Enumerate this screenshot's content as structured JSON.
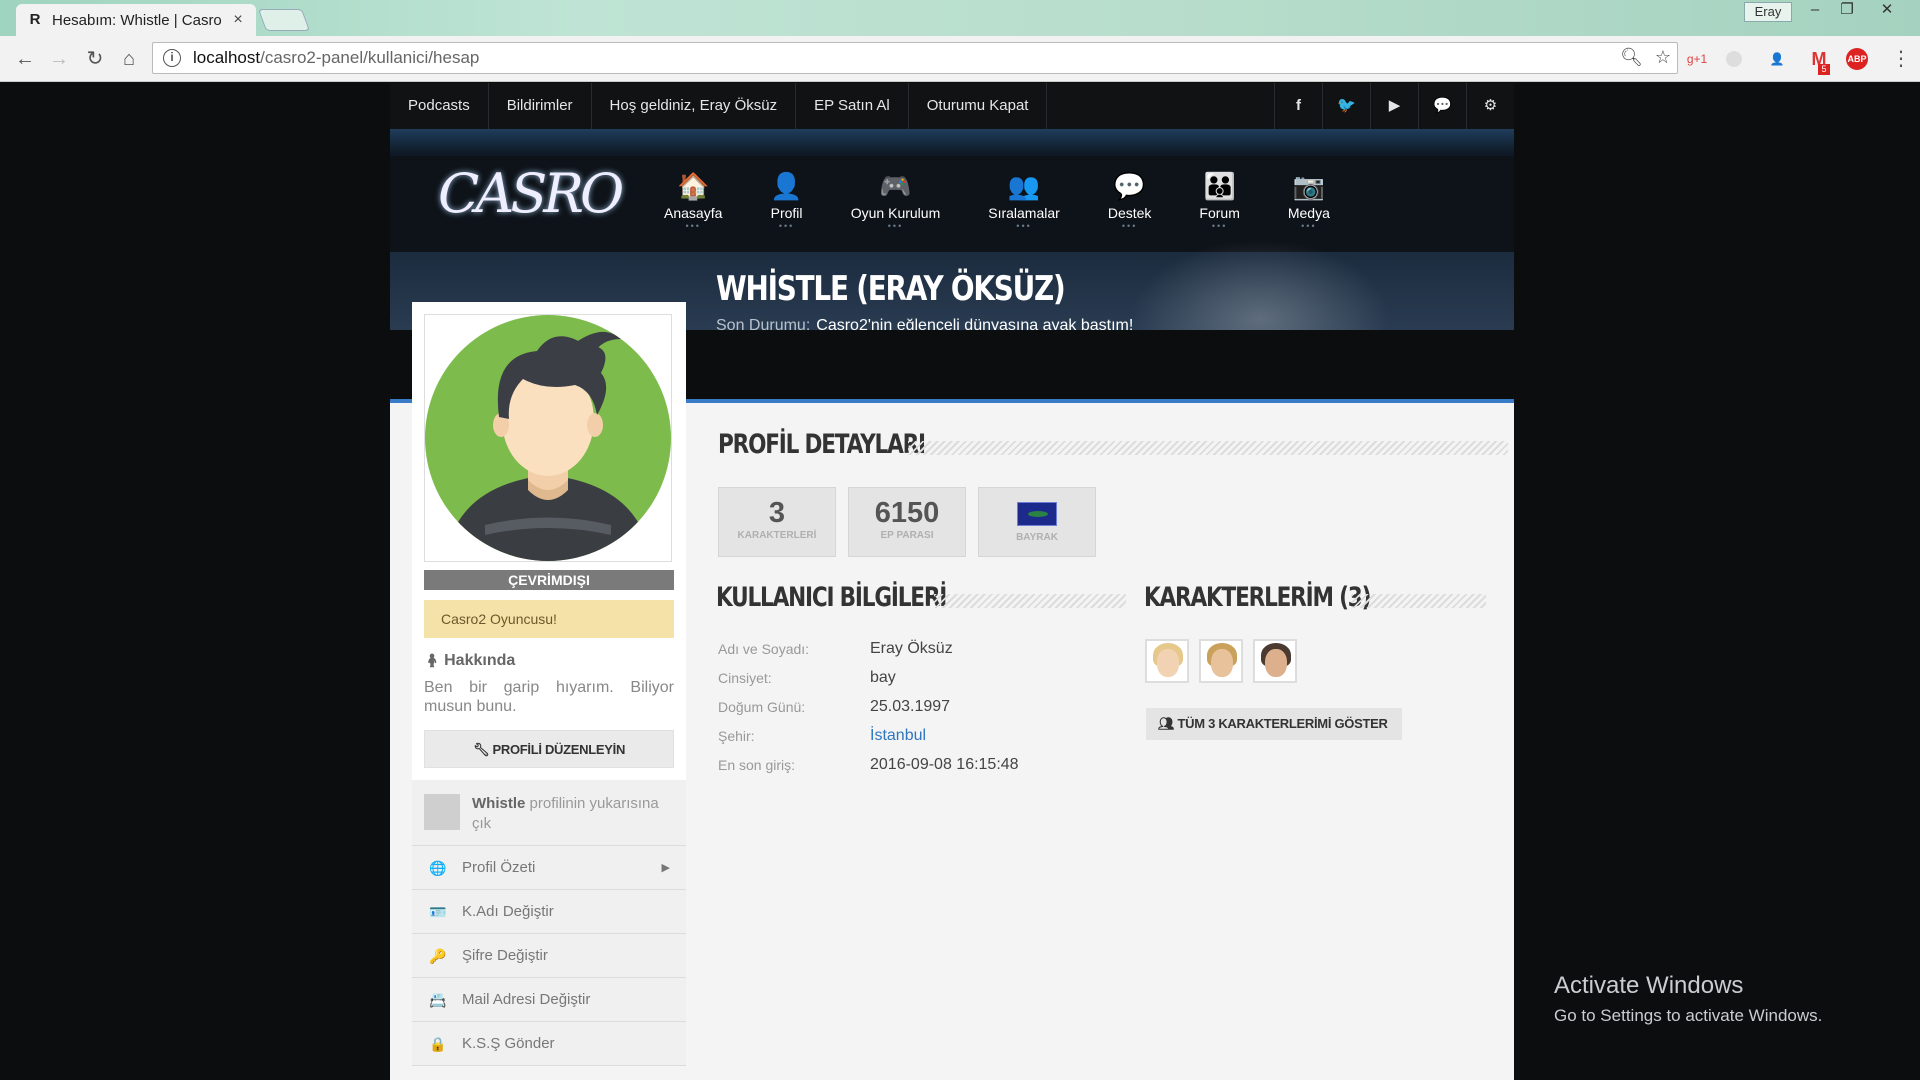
{
  "browser": {
    "tab_title": "Hesabım: Whistle | Casro",
    "tab_favicon": "R",
    "tab_close": "×",
    "profile_chip": "Eray",
    "win_controls": [
      "–",
      "❐",
      "✕"
    ],
    "url_host": "localhost",
    "url_path": "/casro2-panel/kullanici/hesap",
    "nav_icons": [
      "back-icon",
      "forward-icon",
      "reload-icon",
      "home-icon"
    ],
    "extensions": [
      {
        "name": "google-plus-ext",
        "text": "g+1",
        "color": "#d44"
      },
      {
        "name": "gray-ext",
        "text": "",
        "color": "#ddd"
      },
      {
        "name": "user-ext",
        "text": "👤",
        "color": "#2a6ed8"
      },
      {
        "name": "gmail-ext",
        "text": "M",
        "color": "#d33",
        "badge": "5"
      },
      {
        "name": "adblock-ext",
        "text": "ABP",
        "color": "#d22"
      }
    ]
  },
  "topbar": {
    "links": [
      "Podcasts",
      "Bildirimler",
      "Hoş geldiniz, Eray Öksüz",
      "EP Satın Al",
      "Oturumu Kapat"
    ],
    "social": [
      {
        "name": "facebook-icon",
        "glyph": "f"
      },
      {
        "name": "twitter-icon",
        "glyph": "🐦"
      },
      {
        "name": "youtube-icon",
        "glyph": "▶"
      },
      {
        "name": "twitch-icon",
        "glyph": "💬"
      },
      {
        "name": "steam-icon",
        "glyph": "⚙"
      }
    ]
  },
  "logo_text": "CASRO",
  "mainnav": [
    {
      "label": "Anasayfa",
      "icon": "home-icon",
      "glyph": "🏠"
    },
    {
      "label": "Profil",
      "icon": "user-icon",
      "glyph": "👤"
    },
    {
      "label": "Oyun Kurulum",
      "icon": "gamepad-icon",
      "glyph": "🎮"
    },
    {
      "label": "Sıralamalar",
      "icon": "users-icon",
      "glyph": "👥"
    },
    {
      "label": "Destek",
      "icon": "chat-icon",
      "glyph": "💬"
    },
    {
      "label": "Forum",
      "icon": "group-icon",
      "glyph": "👪"
    },
    {
      "label": "Medya",
      "icon": "camera-icon",
      "glyph": "📷"
    }
  ],
  "profile": {
    "name": "WHİSTLE (ERAY ÖKSÜZ)",
    "status_label": "Son Durumu:",
    "status_value": "Casro2'nin eğlenceli dünyasına ayak bastım!",
    "online_state": "ÇEVRİMDIŞI",
    "role": "Casro2 Oyuncusu!",
    "about_title": "Hakkında",
    "about_text": "Ben bir garip hıyarım. Biliyor musun bunu.",
    "edit_button": "PROFİLİ DÜZENLEYİN"
  },
  "sidebar": {
    "top_user": "Whistle",
    "top_text": " profilinin yukarısına çık",
    "items": [
      {
        "label": "Profil Özeti",
        "icon": "globe-icon",
        "glyph": "🌐",
        "arrow": "▶"
      },
      {
        "label": "K.Adı Değiştir",
        "icon": "id-card-icon",
        "glyph": "🪪"
      },
      {
        "label": "Şifre Değiştir",
        "icon": "key-icon",
        "glyph": "🔑"
      },
      {
        "label": "Mail Adresi Değiştir",
        "icon": "address-card-icon",
        "glyph": "📇"
      },
      {
        "label": "K.S.Ş Gönder",
        "icon": "lock-icon",
        "glyph": "🔒"
      }
    ]
  },
  "details": {
    "title": "PROFİL DETAYLARI",
    "stats": [
      {
        "value": "3",
        "label": "KARAKTERLERİ"
      },
      {
        "value": "6150",
        "label": "EP PARASI"
      },
      {
        "value": "",
        "label": "BAYRAK"
      }
    ]
  },
  "user_info": {
    "title": "KULLANICI BİLGİLERİ",
    "rows": [
      {
        "key": "Adı ve Soyadı:",
        "value": "Eray Öksüz"
      },
      {
        "key": "Cinsiyet:",
        "value": "bay"
      },
      {
        "key": "Doğum Günü:",
        "value": "25.03.1997"
      },
      {
        "key": "Şehir:",
        "value": "İstanbul"
      },
      {
        "key": "En son giriş:",
        "value": "2016-09-08 16:15:48"
      }
    ]
  },
  "characters": {
    "title": "KARAKTERLERİM (3)",
    "show_all": "TÜM 3 KARAKTERLERİMİ GÖSTER",
    "avatars": [
      {
        "hair": "#e6c98a",
        "skin": "#f1d3b3"
      },
      {
        "hair": "#c9a15a",
        "skin": "#e8c29a"
      },
      {
        "hair": "#4a3a30",
        "skin": "#dcb08c"
      }
    ]
  },
  "watermark": {
    "line1": "Activate Windows",
    "line2": "Go to Settings to activate Windows."
  }
}
